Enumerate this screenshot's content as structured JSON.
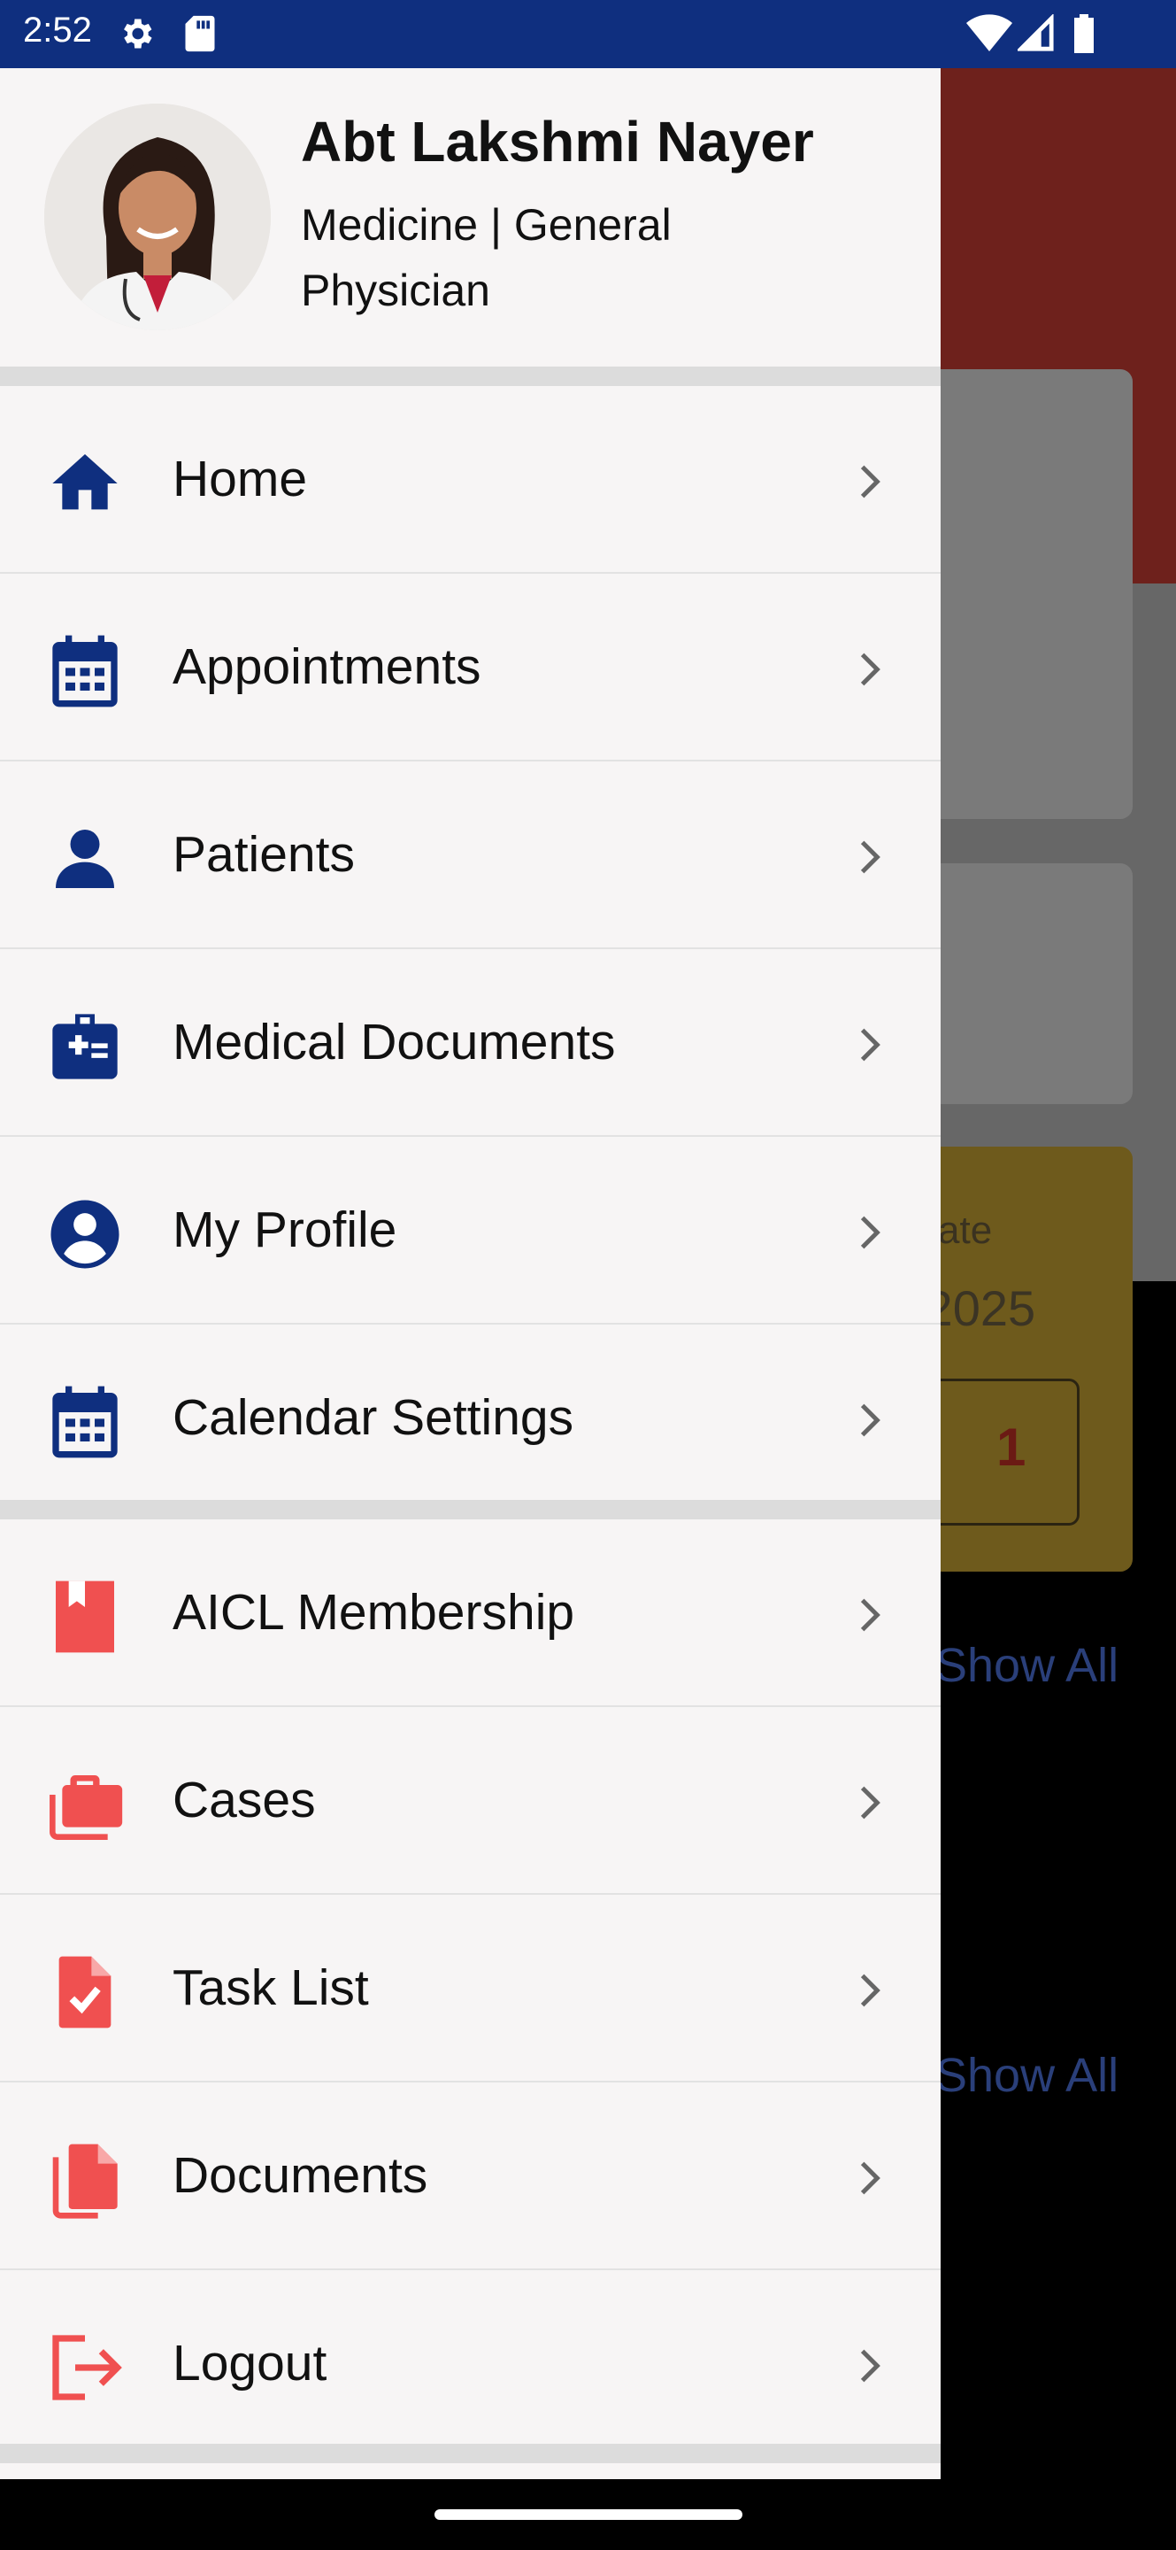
{
  "status_bar": {
    "time": "2:52",
    "icons": [
      "settings-gear-icon",
      "sd-card-icon",
      "wifi-icon",
      "cellular-signal-icon",
      "battery-icon"
    ]
  },
  "drawer": {
    "profile": {
      "name": "Abt Lakshmi Nayer",
      "specialty": "Medicine | General Physician"
    },
    "primary_menu": [
      {
        "label": "Home",
        "icon": "home-icon"
      },
      {
        "label": "Appointments",
        "icon": "calendar-icon"
      },
      {
        "label": "Patients",
        "icon": "person-icon"
      },
      {
        "label": "Medical Documents",
        "icon": "medical-kit-icon"
      },
      {
        "label": "My Profile",
        "icon": "account-circle-icon"
      },
      {
        "label": "Calendar Settings",
        "icon": "calendar-icon"
      }
    ],
    "secondary_menu": [
      {
        "label": "AICL Membership",
        "icon": "bookmark-icon"
      },
      {
        "label": "Cases",
        "icon": "briefcase-icon"
      },
      {
        "label": "Task List",
        "icon": "task-document-icon"
      },
      {
        "label": "Documents",
        "icon": "documents-icon"
      },
      {
        "label": "Logout",
        "icon": "logout-icon"
      }
    ]
  },
  "background": {
    "card_label": "ate",
    "card_value": "/2025",
    "card_count": "1",
    "show_all_1": "Show All",
    "show_all_2": "Show All"
  },
  "colors": {
    "status_bar": "#0f2f7f",
    "primary_icon": "#0f2f7f",
    "secondary_icon": "#f05050",
    "drawer_bg": "#f7f5f5"
  }
}
